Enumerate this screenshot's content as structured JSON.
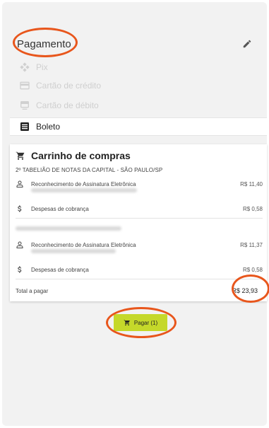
{
  "payment": {
    "title": "Pagamento",
    "edit_icon": "pencil-icon",
    "methods": [
      {
        "label": "Pix",
        "icon": "pix-icon",
        "state": "disabled"
      },
      {
        "label": "Cartão de crédito",
        "icon": "credit-card-icon",
        "state": "disabled"
      },
      {
        "label": "Cartão de débito",
        "icon": "debit-card-icon",
        "state": "disabled"
      },
      {
        "label": "Boleto",
        "icon": "barcode-icon",
        "state": "selected"
      }
    ]
  },
  "cart": {
    "title": "Carrinho de compras",
    "office": "2º TABELIÃO DE NOTAS DA CAPITAL - SÃO PAULO/SP",
    "groups": [
      {
        "items": [
          {
            "icon": "person-badge-icon",
            "label": "Reconhecimento de Assinatura Eletrônica",
            "price": "R$ 11,40"
          },
          {
            "icon": "dollar-icon",
            "label": "Despesas de cobrança",
            "price": "R$ 0,58"
          }
        ]
      },
      {
        "items": [
          {
            "icon": "person-badge-icon",
            "label": "Reconhecimento de Assinatura Eletrônica",
            "price": "R$ 11,37"
          },
          {
            "icon": "dollar-icon",
            "label": "Despesas de cobrança",
            "price": "R$ 0,58"
          }
        ]
      }
    ],
    "total_label": "Total a pagar",
    "total_value": "R$ 23,93"
  },
  "actions": {
    "pay_label": "Pagar (1)"
  },
  "colors": {
    "accent_button": "#c5d82a",
    "annotation_outline": "#e8561c"
  }
}
